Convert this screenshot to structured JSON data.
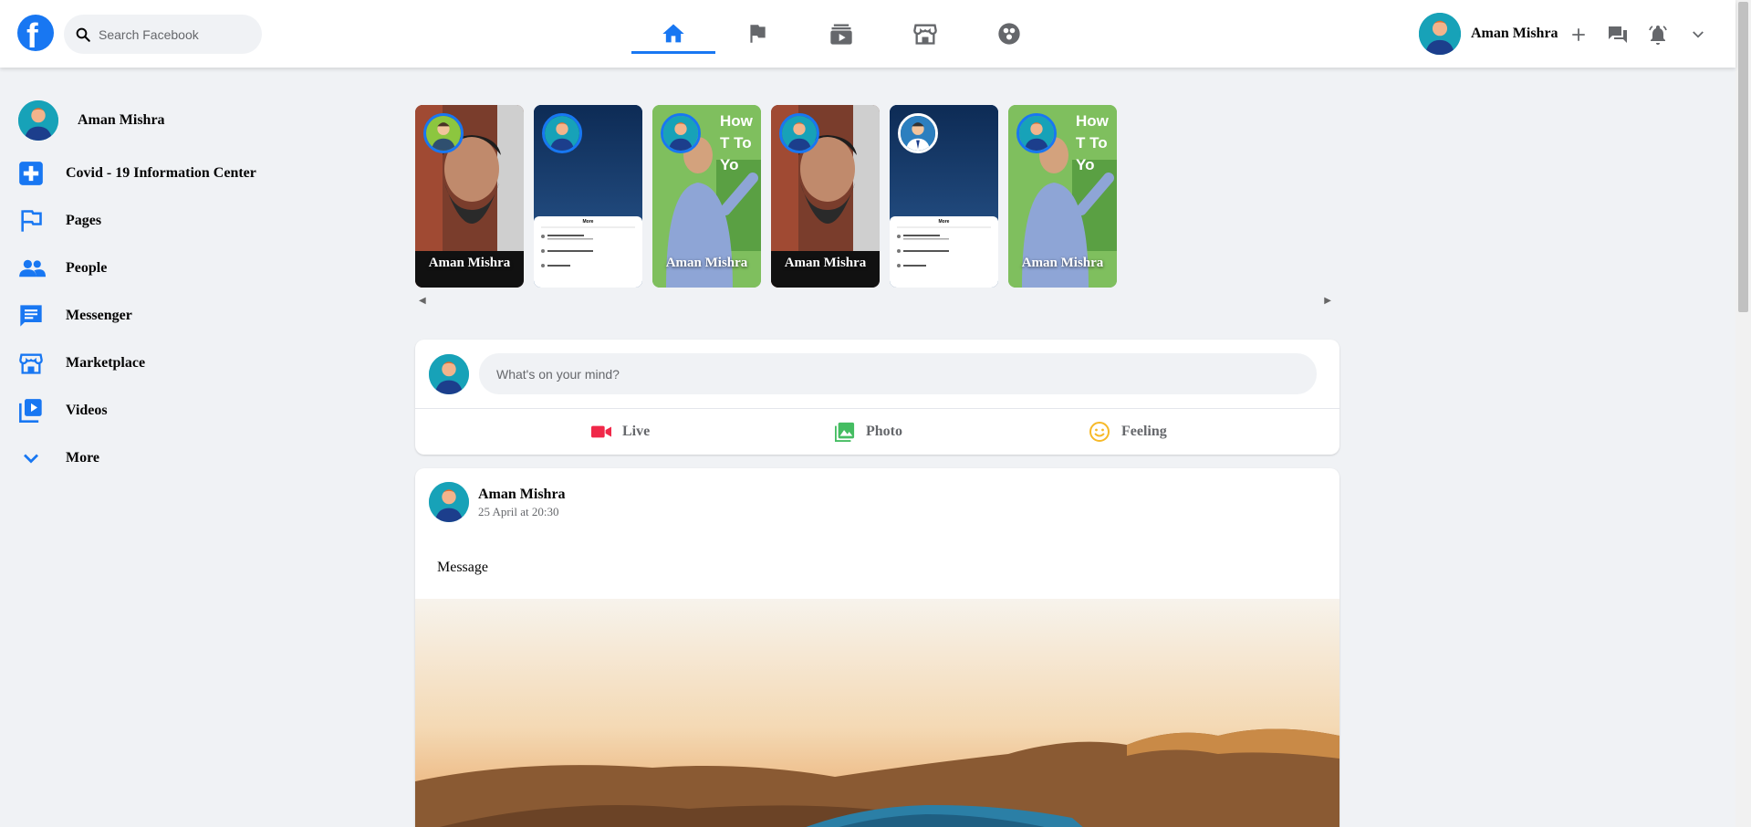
{
  "header": {
    "logo_letter": "f",
    "search": {
      "placeholder": "Search Facebook"
    },
    "nav_tabs": [
      {
        "name": "home",
        "icon": "home-icon",
        "active": true
      },
      {
        "name": "pages",
        "icon": "flag-icon",
        "active": false
      },
      {
        "name": "watch",
        "icon": "video-icon",
        "active": false
      },
      {
        "name": "marketplace",
        "icon": "store-icon",
        "active": false
      },
      {
        "name": "groups",
        "icon": "groups-icon",
        "active": false
      }
    ],
    "user_name": "Aman Mishra",
    "right_icons": [
      "plus-icon",
      "chat-icon",
      "bell-icon",
      "chevron-down-icon"
    ]
  },
  "sidebar": {
    "profile_name": "Aman Mishra",
    "items": [
      {
        "label": "Covid - 19 Information Center",
        "icon": "covid-plus-icon"
      },
      {
        "label": "Pages",
        "icon": "flag-icon"
      },
      {
        "label": "People",
        "icon": "people-icon"
      },
      {
        "label": "Messenger",
        "icon": "messenger-icon"
      },
      {
        "label": "Marketplace",
        "icon": "store-icon"
      },
      {
        "label": "Videos",
        "icon": "video-icon"
      },
      {
        "label": "More",
        "icon": "chevron-down-icon"
      }
    ]
  },
  "stories": [
    {
      "name": "Aman Mishra",
      "kind": "beard"
    },
    {
      "name": "",
      "kind": "screen"
    },
    {
      "name": "Aman Mishra",
      "kind": "presenter",
      "overlay": "How T To Yo"
    },
    {
      "name": "Aman Mishra",
      "kind": "beard"
    },
    {
      "name": "",
      "kind": "screen"
    },
    {
      "name": "Aman Mishra",
      "kind": "presenter",
      "overlay": "How T To Yo"
    }
  ],
  "story_screen_menu": {
    "title": "More",
    "items": [
      "Edit story privacy",
      "Saw something wrong",
      "Save photo"
    ]
  },
  "composer": {
    "placeholder": "What's on your mind?",
    "actions": [
      {
        "label": "Live",
        "icon": "live-video-icon",
        "color": "#f02849"
      },
      {
        "label": "Photo",
        "icon": "photo-icon",
        "color": "#45bd62"
      },
      {
        "label": "Feeling",
        "icon": "smile-icon",
        "color": "#f7b928"
      }
    ]
  },
  "post": {
    "author": "Aman Mishra",
    "time": "25 April at 20:30",
    "message": "Message"
  },
  "colors": {
    "brand": "#1877f2",
    "background": "#f0f2f5",
    "secondary_text": "#65676b"
  }
}
